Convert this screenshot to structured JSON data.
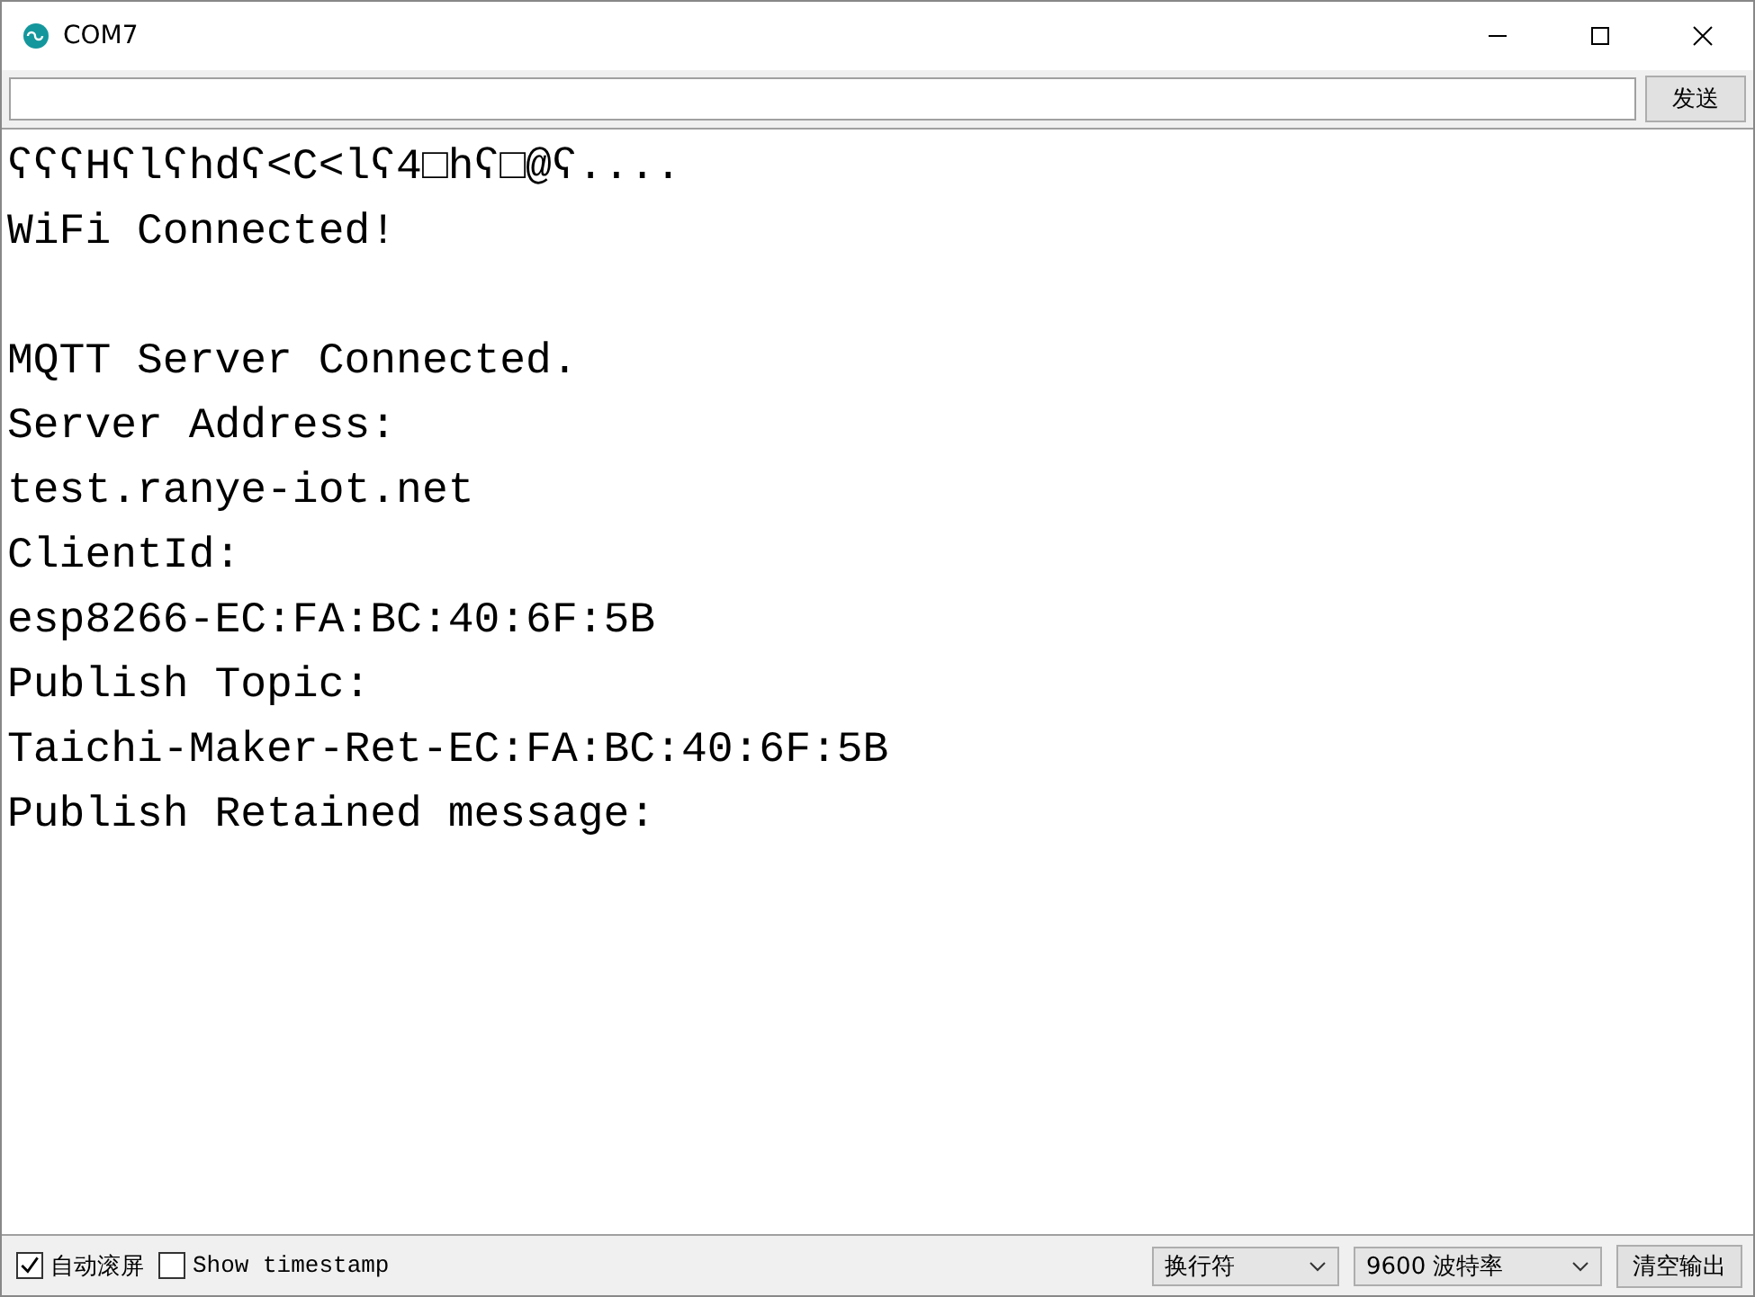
{
  "window": {
    "title": "COM7"
  },
  "send_bar": {
    "button": "发送"
  },
  "output": {
    "lines": [
      {
        "kind": "text",
        "text": "ʕʕʕHʕlʕhdʕ<C<lʕ4□hʕ□@ʕ...."
      },
      {
        "kind": "text",
        "text": "WiFi Connected!"
      },
      {
        "kind": "blank"
      },
      {
        "kind": "text",
        "text": "MQTT Server Connected."
      },
      {
        "kind": "text",
        "text": "Server Address:"
      },
      {
        "kind": "text",
        "text": "test.ranye-iot.net"
      },
      {
        "kind": "text",
        "text": "ClientId:"
      },
      {
        "kind": "text",
        "text": "esp8266-EC:FA:BC:40:6F:5B"
      },
      {
        "kind": "text",
        "text": "Publish Topic:"
      },
      {
        "kind": "text",
        "text": "Taichi-Maker-Ret-EC:FA:BC:40:6F:5B"
      },
      {
        "kind": "text",
        "text": "Publish Retained message:"
      }
    ]
  },
  "footer": {
    "autoscroll": {
      "label": "自动滚屏",
      "checked": true
    },
    "timestamp": {
      "label": "Show timestamp",
      "checked": false
    },
    "line_ending": "换行符",
    "baud": "9600 波特率",
    "clear_button": "清空输出"
  }
}
